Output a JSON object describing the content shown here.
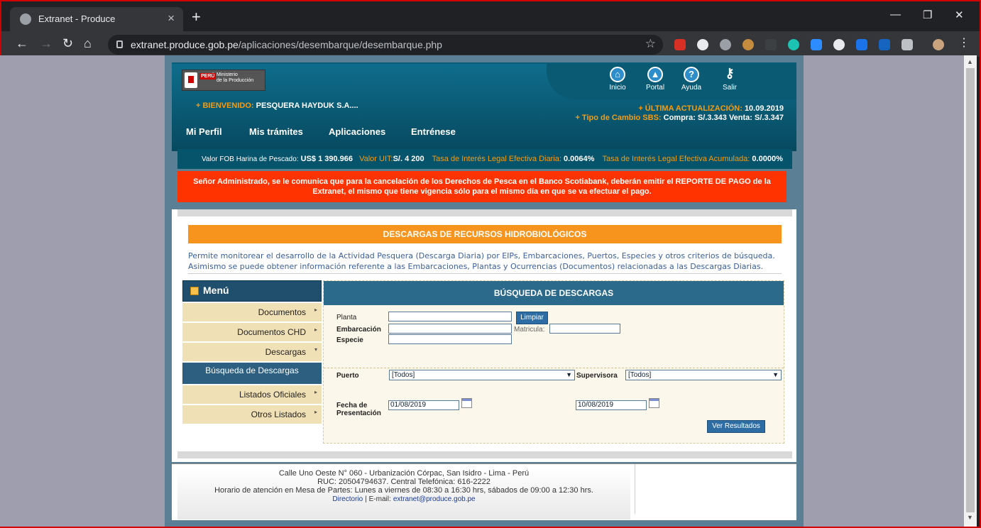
{
  "browser": {
    "tab_title": "Extranet - Produce",
    "url_host": "extranet.produce.gob.pe",
    "url_path": "/aplicaciones/desembarque/desembarque.php"
  },
  "header": {
    "logo_peru": "PERÚ",
    "logo_ministry_1": "Ministerio",
    "logo_ministry_2": "de la Producción",
    "icons": [
      {
        "label": "Inicio",
        "icon": "home-icon"
      },
      {
        "label": "Portal",
        "icon": "portal-icon"
      },
      {
        "label": "Ayuda",
        "icon": "help-icon"
      },
      {
        "label": "Salir",
        "icon": "key-icon"
      }
    ],
    "welcome_label": "+ BIENVENIDO:",
    "welcome_name": "PESQUERA HAYDUK S.A....",
    "update_label": "+ ÚLTIMA ACTUALIZACIÓN:",
    "update_value": "10.09.2019",
    "exchange_label": "+ Tipo de Cambio SBS:",
    "exchange_value": "Compra: S/.3.343 Venta: S/.3.347",
    "menu": [
      "Mi Perfil",
      "Mis trámites",
      "Aplicaciones",
      "Entrénese"
    ]
  },
  "rates": {
    "fob_label": "Valor FOB Harina de Pescado:",
    "fob_value": "US$ 1 390.966",
    "uit_label": "Valor UIT:",
    "uit_value": "S/. 4 200",
    "daily_label": "Tasa de Interés Legal Efectiva Diaria:",
    "daily_value": "0.0064%",
    "acc_label": "Tasa de Interés Legal Efectiva Acumulada:",
    "acc_value": "0.0000%"
  },
  "notice": {
    "line1": "Señor Administrado, se le comunica que para la cancelación de los Derechos de Pesca en el Banco Scotiabank, deberán emitir el REPORTE DE PAGO de la",
    "line2": "Extranet, el mismo que tiene vigencia sólo para el mismo día en que se va efectuar el pago."
  },
  "section": {
    "title": "DESCARGAS DE RECURSOS HIDROBIOLÓGICOS",
    "desc1": "Permite monitorear el desarrollo de la Actividad Pesquera (Descarga Diaria) por EIPs, Embarcaciones, Puertos, Especies y otros criterios de búsqueda.",
    "desc2": "Asimismo se puede obtener información referente a las Embarcaciones, Plantas y Ocurrencias (Documentos) relacionadas a las Descargas Diarias."
  },
  "left_menu": {
    "title": "Menú",
    "items": [
      "Documentos",
      "Documentos CHD",
      "Descargas",
      "Búsqueda de Descargas",
      "Listados Oficiales",
      "Otros Listados"
    ]
  },
  "search": {
    "title": "BÚSQUEDA DE DESCARGAS",
    "planta_label": "Planta",
    "planta_value": "",
    "limpiar": "Limpiar",
    "embarcacion_label": "Embarcación",
    "embarcacion_value": "",
    "matricula_label": "Matricula:",
    "matricula_value": "",
    "especie_label": "Especie",
    "especie_value": "",
    "puerto_label": "Puerto",
    "puerto_value": "[Todos]",
    "supervisora_label": "Supervisora",
    "supervisora_value": "[Todos]",
    "fecha_label_1": "Fecha de",
    "fecha_label_2": "Presentación",
    "fecha_desde": "01/08/2019",
    "fecha_hasta": "10/08/2019",
    "ver_resultados": "Ver Resultados"
  },
  "footer": {
    "line1": "Calle Uno Oeste N° 060 - Urbanización Córpac, San Isidro - Lima - Perú",
    "line2": "RUC: 20504794637. Central Telefónica: 616-2222",
    "line3": "Horario de atención en Mesa de Partes: Lunes a viernes de 08:30 a 16:30 hrs, sábados de 09:00 a 12:30 hrs.",
    "directorio": "Directorio",
    "email_label": "| E-mail:",
    "email": "extranet@produce.gob.pe"
  }
}
